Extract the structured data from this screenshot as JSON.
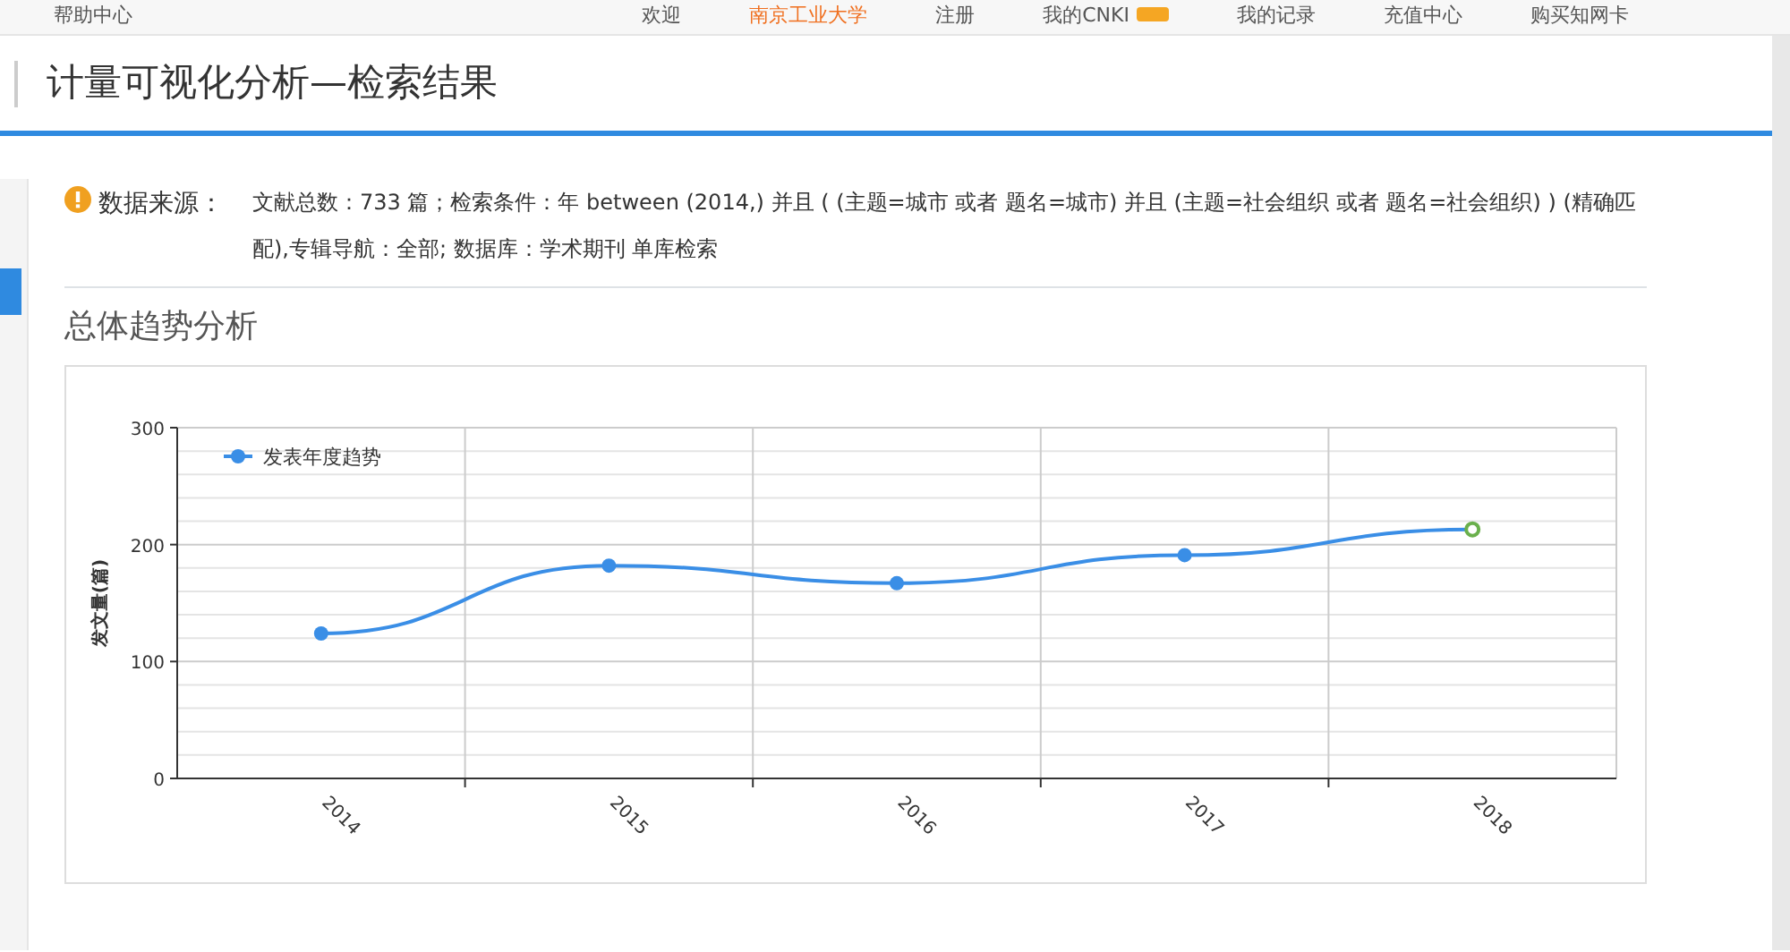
{
  "top_nav": {
    "left": "帮助中心",
    "items": [
      {
        "label": "欢迎",
        "kind": "text"
      },
      {
        "label": "南京工业大学",
        "kind": "org"
      },
      {
        "label": "注册",
        "kind": "link"
      },
      {
        "label": "我的CNKI",
        "kind": "badge"
      },
      {
        "label": "我的记录",
        "kind": "dropdown"
      },
      {
        "label": "充值中心",
        "kind": "link"
      },
      {
        "label": "购买知网卡",
        "kind": "link"
      }
    ]
  },
  "page_title": "计量可视化分析—检索结果",
  "source": {
    "label": "数据来源：",
    "text": "文献总数：733 篇；检索条件：年 between (2014,) 并且 ( (主题=城市 或者 题名=城市) 并且 (主题=社会组织 或者 题名=社会组织) ) (精确匹配),专辑导航：全部; 数据库：学术期刊 单库检索"
  },
  "section_title": "总体趋势分析",
  "chart": {
    "forecast_last": true,
    "chart_data": {
      "type": "line",
      "ylabel": "发文量(篇)",
      "categories": [
        "2014",
        "2015",
        "2016",
        "2017",
        "2018"
      ],
      "series": [
        {
          "name": "发表年度趋势",
          "color": "#3a8ee6",
          "marker": "circle",
          "values": [
            124,
            182,
            167,
            191,
            213
          ]
        }
      ],
      "ylim": [
        0,
        300
      ],
      "yticks": [
        0,
        100,
        200,
        300
      ]
    }
  }
}
